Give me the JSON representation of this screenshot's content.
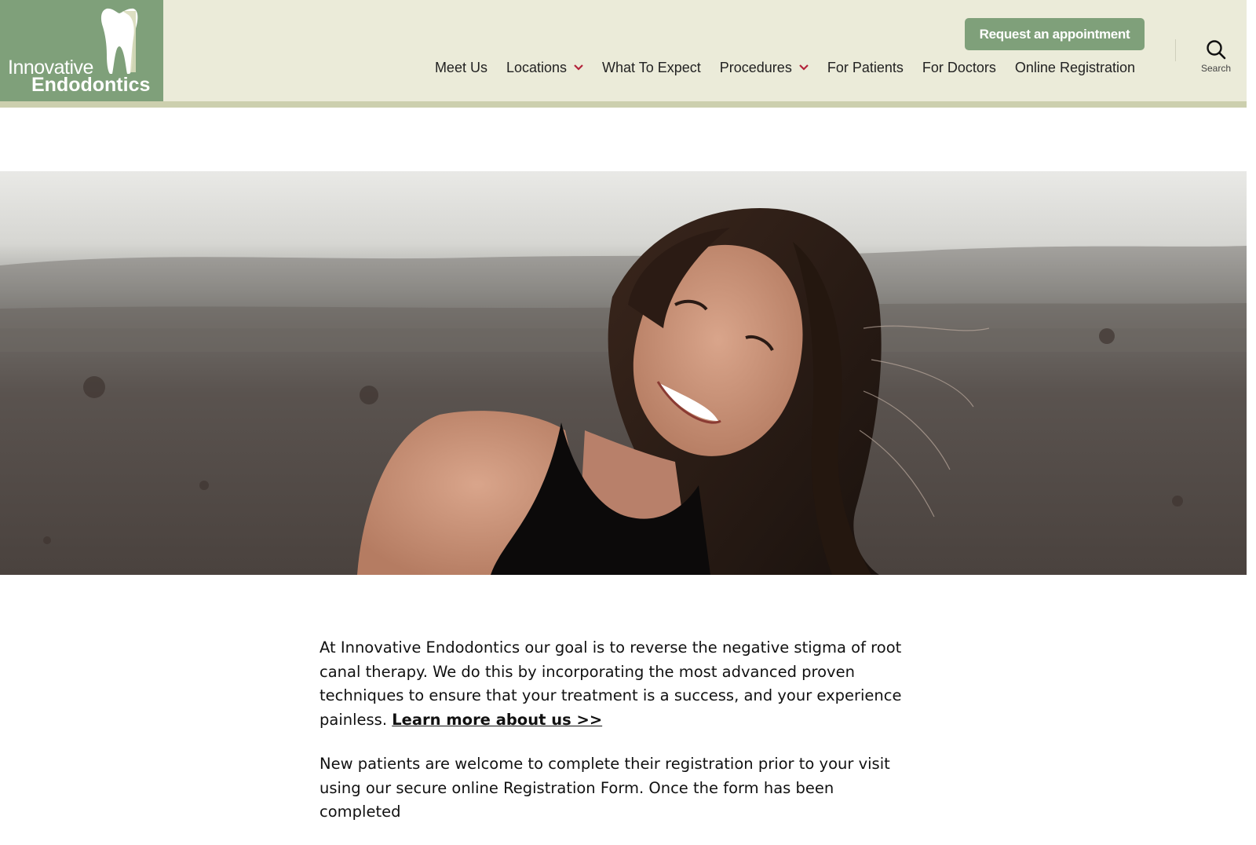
{
  "logo": {
    "line1": "Innovative",
    "line2": "Endodontics",
    "icon": "tooth-icon",
    "color": "#7fa07a"
  },
  "header": {
    "cta_label": "Request an appointment",
    "search_label": "Search",
    "background": "#ebebd9",
    "nav": [
      {
        "label": "Meet Us",
        "dropdown": false
      },
      {
        "label": "Locations",
        "dropdown": true
      },
      {
        "label": "What To Expect",
        "dropdown": false
      },
      {
        "label": "Procedures",
        "dropdown": true
      },
      {
        "label": "For Patients",
        "dropdown": false
      },
      {
        "label": "For Doctors",
        "dropdown": false
      },
      {
        "label": "Online Registration",
        "dropdown": false
      }
    ],
    "chevron_color": "#b3233a"
  },
  "hero": {
    "subject": "smiling woman with long brown hair in a misty field"
  },
  "content": {
    "paragraph1": "At Innovative Endodontics our goal is to reverse the negative stigma of root canal therapy. We do this by incorporating the most advanced proven techniques to ensure that your treatment is a success, and your experience painless.",
    "paragraph1_link": "Learn more about us >>",
    "paragraph2": "New patients are welcome to complete their registration prior to your visit using our secure online Registration Form. Once the form has been completed"
  }
}
